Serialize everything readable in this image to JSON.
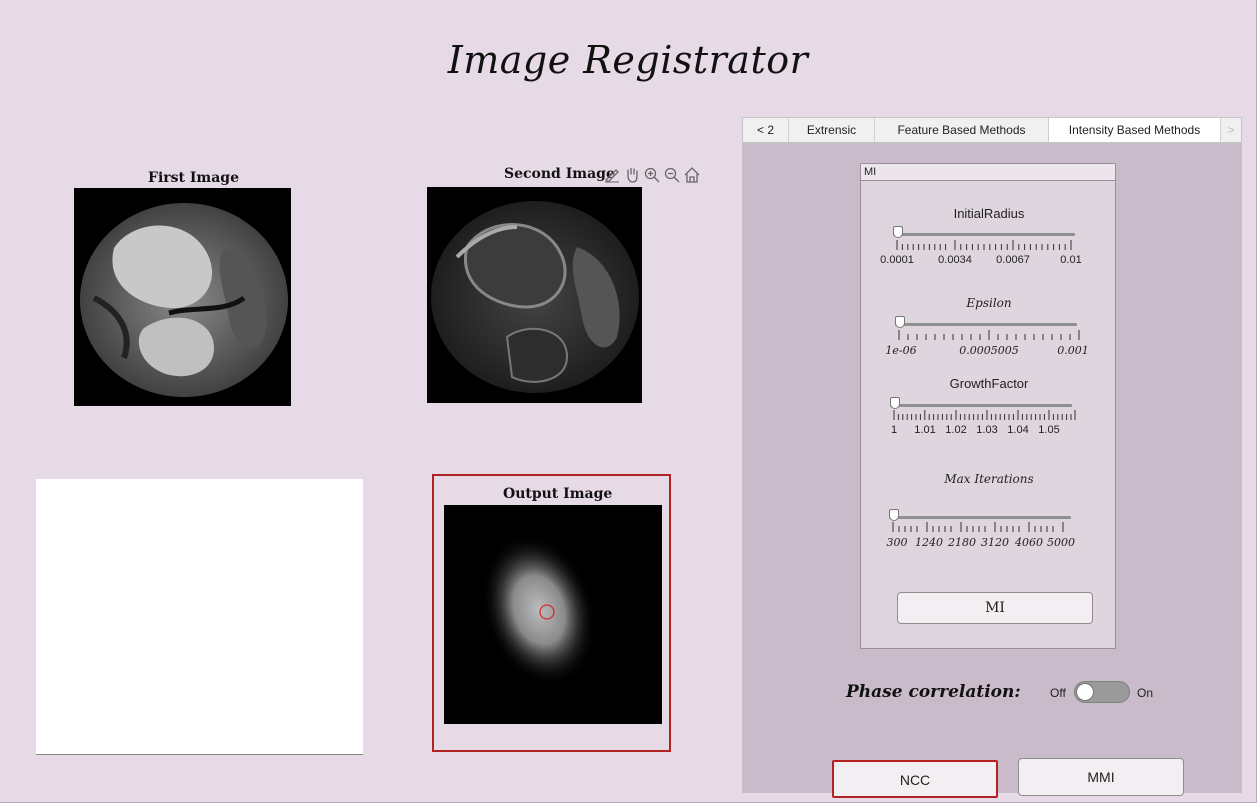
{
  "app": {
    "title": "Image Registrator"
  },
  "axes": {
    "first_title": "First Image",
    "second_title": "Second Image",
    "output_title": "Output Image"
  },
  "toolbar": {
    "icons": [
      "brush-icon",
      "pan-hand-icon",
      "zoom-in-icon",
      "zoom-out-icon",
      "home-icon"
    ]
  },
  "tabs": {
    "prev_label": "< 2",
    "items": [
      {
        "label": "Extrensic"
      },
      {
        "label": "Feature Based Methods"
      },
      {
        "label": "Intensity Based Methods"
      }
    ],
    "next_label": ">"
  },
  "mi_panel": {
    "header": "MI",
    "sliders": [
      {
        "label": "InitialRadius",
        "value": 0.0001,
        "ticks": [
          "0.0001",
          "0.0034",
          "0.0067",
          "0.01"
        ]
      },
      {
        "label": "Epsilon",
        "value": "1e-06",
        "ticks": [
          "1e-06",
          "0.0005005",
          "0.001"
        ]
      },
      {
        "label": "GrowthFactor",
        "value": 1,
        "ticks": [
          "1",
          "1.01",
          "1.02",
          "1.03",
          "1.04",
          "1.05"
        ]
      },
      {
        "label": "Max Iterations",
        "value": 300,
        "ticks": [
          "300",
          "1240",
          "2180",
          "3120",
          "4060",
          "5000"
        ]
      }
    ],
    "button_label": "MI"
  },
  "phase_correlation": {
    "label": "Phase correlation:",
    "off_label": "Off",
    "on_label": "On",
    "state": "Off"
  },
  "buttons": {
    "ncc_label": "NCC",
    "mmi_label": "MMI"
  },
  "colors": {
    "background": "#e7dae7",
    "panel": "#c9bbc9",
    "highlight": "#b22222"
  }
}
